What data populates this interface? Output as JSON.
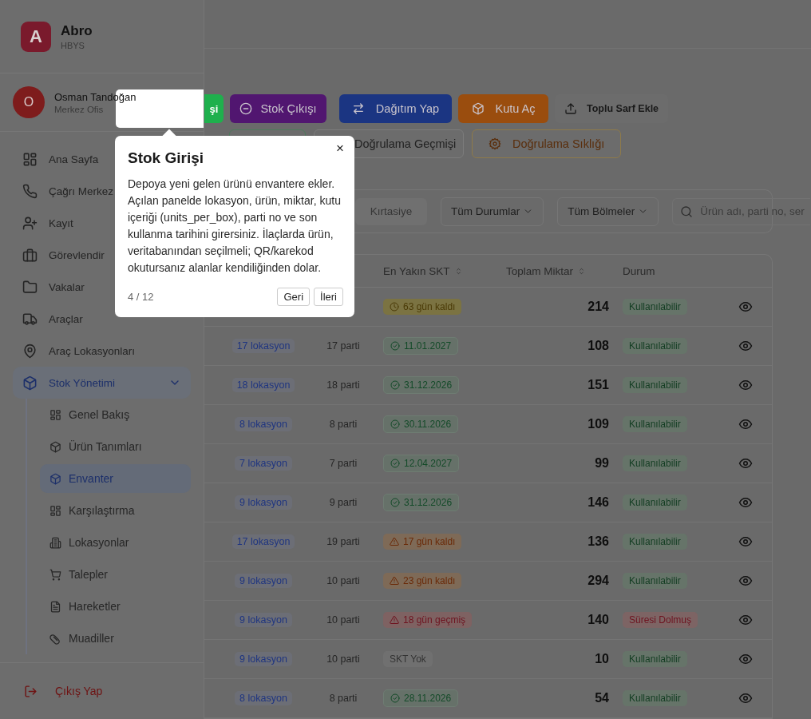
{
  "app": {
    "name": "Abro",
    "subtitle": "HBYS",
    "logo": "A"
  },
  "user": {
    "name": "Osman Tandoğan",
    "office": "Merkez Ofis",
    "initial": "O"
  },
  "sidebar": {
    "items": [
      {
        "label": "Ana Sayfa",
        "selected": false
      },
      {
        "label": "Çağrı Merkez",
        "selected": false
      },
      {
        "label": "Kayıt",
        "selected": false
      },
      {
        "label": "Görevlendir",
        "selected": false
      },
      {
        "label": "Vakalar",
        "selected": false
      },
      {
        "label": "Araçlar",
        "selected": false
      },
      {
        "label": "Araç Lokasyonları",
        "selected": false
      },
      {
        "label": "Stok Yönetimi",
        "selected": true,
        "expanded": true,
        "children": [
          {
            "label": "Genel Bakış",
            "selected": false
          },
          {
            "label": "Ürün Tanımları",
            "selected": false
          },
          {
            "label": "Envanter",
            "selected": true
          },
          {
            "label": "Karşılaştırma",
            "selected": false
          },
          {
            "label": "Lokasyonlar",
            "selected": false
          },
          {
            "label": "Talepler",
            "selected": false
          },
          {
            "label": "Hareketler",
            "selected": false
          },
          {
            "label": "Muadiller",
            "selected": false
          }
        ]
      }
    ],
    "logout": "Çıkış Yap"
  },
  "toolbar": {
    "primary": [
      {
        "label": "şi",
        "kind": "success"
      },
      {
        "label": "Stok Çıkışı",
        "kind": "purple"
      },
      {
        "label": "Dağıtım Yap",
        "kind": "blue"
      },
      {
        "label": "Kutu Aç",
        "kind": "orange"
      },
      {
        "label": "Toplu Sarf Ekle",
        "kind": "plain"
      }
    ],
    "secondary": [
      {
        "label": "Doğrulama Geçmişi",
        "kind": "neutral"
      },
      {
        "label": "Doğrulama Sıklığı",
        "kind": "warning"
      }
    ]
  },
  "filters": {
    "chips": [
      {
        "label": "Kırtasiye",
        "selected": false
      }
    ],
    "selects": [
      "Tüm Durumlar",
      "Tüm Bölmeler"
    ],
    "search": {
      "placeholder": "Ürün adı, parti no, ser"
    }
  },
  "table": {
    "columns": [
      {
        "label": "En Yakın SKT",
        "sortable": true
      },
      {
        "label": "Toplam Miktar",
        "sortable": true
      },
      {
        "label": "Durum",
        "sortable": false
      }
    ],
    "rows": [
      {
        "expiry": {
          "kind": "soon",
          "text": "63 gün kaldı"
        },
        "quantity": "214",
        "status": {
          "kind": "ok",
          "text": "Kullanılabilir"
        }
      },
      {
        "locations": "17 lokasyon",
        "batches": "17 parti",
        "expiry": {
          "kind": "ok",
          "text": "11.01.2027"
        },
        "quantity": "108",
        "status": {
          "kind": "ok",
          "text": "Kullanılabilir"
        }
      },
      {
        "locations": "18 lokasyon",
        "batches": "18 parti",
        "expiry": {
          "kind": "ok",
          "text": "31.12.2026"
        },
        "quantity": "151",
        "status": {
          "kind": "ok",
          "text": "Kullanılabilir"
        }
      },
      {
        "locations": "8 lokasyon",
        "batches": "8 parti",
        "expiry": {
          "kind": "ok",
          "text": "30.11.2026"
        },
        "quantity": "109",
        "status": {
          "kind": "ok",
          "text": "Kullanılabilir"
        }
      },
      {
        "locations": "7 lokasyon",
        "batches": "7 parti",
        "expiry": {
          "kind": "ok",
          "text": "12.04.2027"
        },
        "quantity": "99",
        "status": {
          "kind": "ok",
          "text": "Kullanılabilir"
        }
      },
      {
        "locations": "9 lokasyon",
        "batches": "9 parti",
        "expiry": {
          "kind": "ok",
          "text": "31.12.2026"
        },
        "quantity": "146",
        "status": {
          "kind": "ok",
          "text": "Kullanılabilir"
        }
      },
      {
        "locations": "17 lokasyon",
        "batches": "19 parti",
        "expiry": {
          "kind": "warning",
          "text": "17 gün kaldı"
        },
        "quantity": "136",
        "status": {
          "kind": "ok",
          "text": "Kullanılabilir"
        }
      },
      {
        "locations": "9 lokasyon",
        "batches": "10 parti",
        "expiry": {
          "kind": "warning",
          "text": "23 gün kaldı"
        },
        "quantity": "294",
        "status": {
          "kind": "ok",
          "text": "Kullanılabilir"
        }
      },
      {
        "locations": "9 lokasyon",
        "batches": "10 parti",
        "expiry": {
          "kind": "expired",
          "text": "18 gün geçmiş"
        },
        "quantity": "140",
        "status": {
          "kind": "expired",
          "text": "Süresi Dolmuş"
        }
      },
      {
        "locations": "9 lokasyon",
        "batches": "10 parti",
        "expiry": {
          "kind": "none",
          "text": "SKT Yok"
        },
        "quantity": "10",
        "status": {
          "kind": "ok",
          "text": "Kullanılabilir"
        }
      },
      {
        "locations": "8 lokasyon",
        "batches": "8 parti",
        "expiry": {
          "kind": "ok",
          "text": "28.11.2026"
        },
        "quantity": "54",
        "status": {
          "kind": "ok",
          "text": "Kullanılabilir"
        }
      }
    ]
  },
  "tour": {
    "title": "Stok Girişi",
    "body": "Depoya yeni gelen ürünü envantere ekler. Açılan panelde lokasyon, ürün, miktar, kutu içeriği (units_per_box), parti no ve son kullanma tarihini girersiniz. İlaçlarda ürün, veritabanından seçilmeli; QR/karekod okutursanız alanlar kendiliğinden dolar.",
    "progress": "4 / 12",
    "buttons": [
      "Geri",
      "İleri"
    ],
    "close": "×"
  }
}
